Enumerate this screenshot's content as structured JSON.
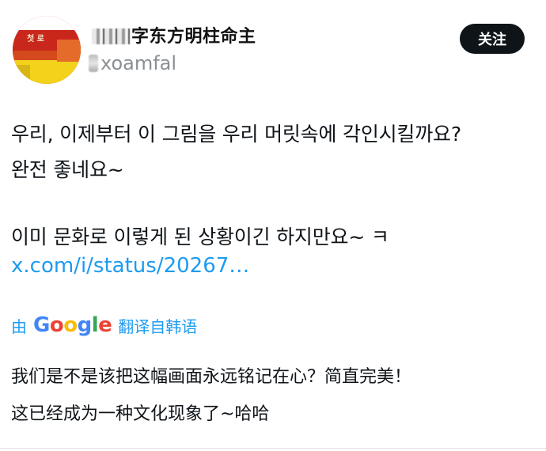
{
  "header": {
    "display_name_visible": "东方明柱命主",
    "display_name_partial": "字",
    "handle_visible": "xoamfal",
    "follow_label": "关注",
    "avatar_text": "첫 로"
  },
  "tweet": {
    "lines": [
      "우리, 이제부터 이 그림을 우리 머릿속에 각인시킬까요?",
      "완전 좋네요~",
      "이미 문화로 이렇게 된 상황이긴 하지만요~ ㅋ"
    ],
    "link": "x.com/i/status/20267…"
  },
  "translation": {
    "prefix": "由",
    "logo_letters": [
      "G",
      "o",
      "o",
      "g",
      "l",
      "e"
    ],
    "suffix": "翻译自韩语",
    "lines": [
      "我们是不是该把这幅画面永远铭记在心？简直完美！",
      "这已经成为一种文化现象了~哈哈"
    ]
  },
  "colors": {
    "link": "#1d9bf0",
    "button_bg": "#0f1419",
    "handle": "#8a8f94"
  }
}
